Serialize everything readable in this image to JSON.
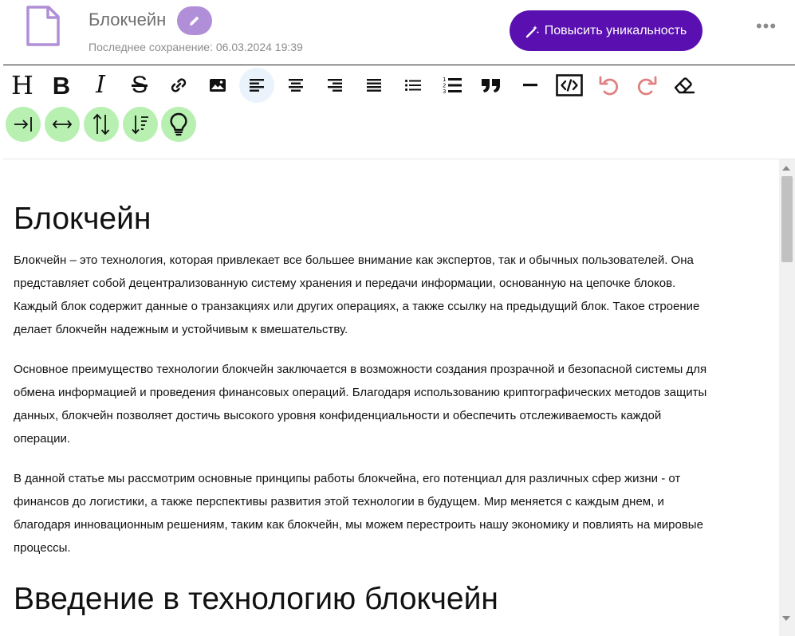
{
  "header": {
    "doc_icon": "document-icon",
    "title": "Блокчейн",
    "edit_icon": "pencil-icon",
    "saved_text": "Последнее сохранение: 06.03.2024 19:39",
    "boost_button_label": "Повысить уникальность",
    "boost_icon": "magic-wand-icon",
    "more_icon": "more-dots-icon",
    "more_label": "•••",
    "brand_color": "#5a10b0",
    "edit_color": "#b08fd8"
  },
  "toolbar": {
    "heading_label": "H",
    "bold_label": "B",
    "italic_label": "I",
    "strike_label": "S",
    "active_color": "#eaf3fc",
    "green_color": "#b7f0b1",
    "undo_redo_color": "#e08080",
    "row1_icons": [
      "heading-icon",
      "bold-icon",
      "italic-icon",
      "strikethrough-icon",
      "link-icon",
      "image-icon",
      "align-left-icon",
      "align-center-icon",
      "align-right-icon",
      "align-justify-icon",
      "bullet-list-icon",
      "numbered-list-icon",
      "quote-icon",
      "horizontal-rule-icon",
      "code-view-icon",
      "undo-icon",
      "redo-icon",
      "eraser-icon"
    ],
    "row2_icons": [
      "indent-icon",
      "expand-horizontal-icon",
      "sort-vertical-icon",
      "sort-descending-icon",
      "lightbulb-icon"
    ]
  },
  "content": {
    "h1": "Блокчейн",
    "p1_lines": [
      "Блокчейн – это технология, которая привлекает все большее внимание как экспертов, так и обычных пользователей. Она",
      "представляет собой децентрализованную систему хранения и передачи информации, основанную на цепочке блоков.",
      "Каждый блок содержит данные о транзакциях или других операциях, а также ссылку на предыдущий блок. Такое строение",
      "делает блокчейн надежным и устойчивым к вмешательству."
    ],
    "p2_lines": [
      "Основное преимущество технологии блокчейн заключается в возможности создания прозрачной и безопасной системы для",
      "обмена информацией и проведения финансовых операций. Благодаря использованию криптографических методов защиты",
      "данных, блокчейн позволяет достичь высокого уровня конфиденциальности и обеспечить отслеживаемость каждой",
      "операции."
    ],
    "p3_lines": [
      "В данной статье мы рассмотрим основные принципы работы блокчейна, его потенциал для различных сфер жизни - от",
      "финансов до логистики, а также перспективы развития этой технологии в будущем. Мир меняется с каждым днем, и",
      "благодаря инновационным решениям, таким как блокчейн, мы можем перестроить нашу экономику и повлиять на мировые",
      "процессы."
    ],
    "h2": "Введение в технологию блокчейн"
  }
}
